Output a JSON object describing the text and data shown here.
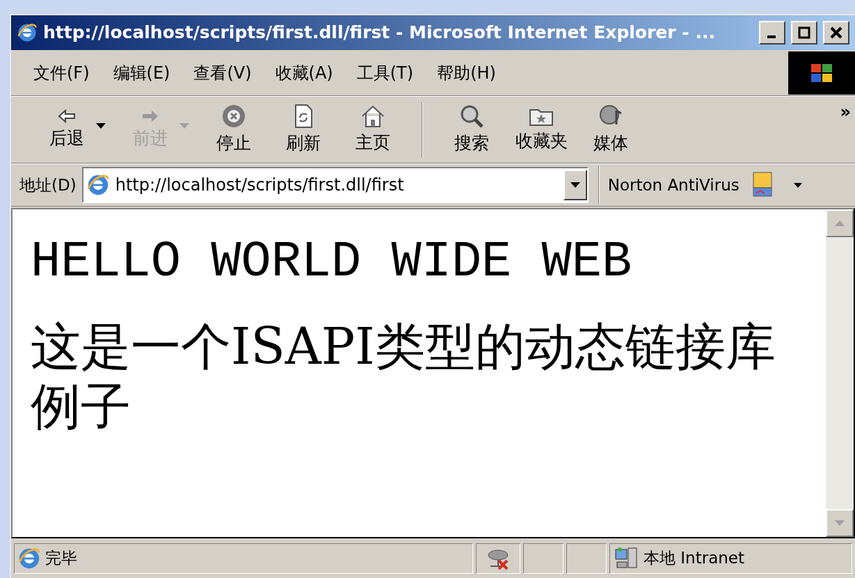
{
  "window": {
    "title": "http://localhost/scripts/first.dll/first - Microsoft Internet Explorer - ..."
  },
  "menu": [
    {
      "label": "文件(F)"
    },
    {
      "label": "编辑(E)"
    },
    {
      "label": "查看(V)"
    },
    {
      "label": "收藏(A)"
    },
    {
      "label": "工具(T)"
    },
    {
      "label": "帮助(H)"
    }
  ],
  "toolbar": {
    "buttons": [
      {
        "kind": "back",
        "label": "后退",
        "disabled": false,
        "dropdown": true
      },
      {
        "kind": "forward",
        "label": "前进",
        "disabled": true,
        "dropdown": true
      },
      {
        "kind": "stop",
        "label": "停止",
        "disabled": false,
        "dropdown": false
      },
      {
        "kind": "refresh",
        "label": "刷新",
        "disabled": false,
        "dropdown": false
      },
      {
        "kind": "home",
        "label": "主页",
        "disabled": false,
        "dropdown": false
      },
      {
        "kind": "separator"
      },
      {
        "kind": "search",
        "label": "搜索",
        "disabled": false,
        "dropdown": false
      },
      {
        "kind": "favorites",
        "label": "收藏夹",
        "disabled": false,
        "dropdown": false
      },
      {
        "kind": "media",
        "label": "媒体",
        "disabled": false,
        "dropdown": false
      }
    ],
    "more": "»"
  },
  "address": {
    "label": "地址(D)",
    "value": "http://localhost/scripts/first.dll/first",
    "plugin": "Norton AntiVirus"
  },
  "content": {
    "heading": "HELLO WORLD WIDE WEB",
    "paragraph": "这是一个ISAPI类型的动态链接库例子"
  },
  "status_bar": {
    "text": "完毕",
    "zone": "本地 Intranet"
  }
}
